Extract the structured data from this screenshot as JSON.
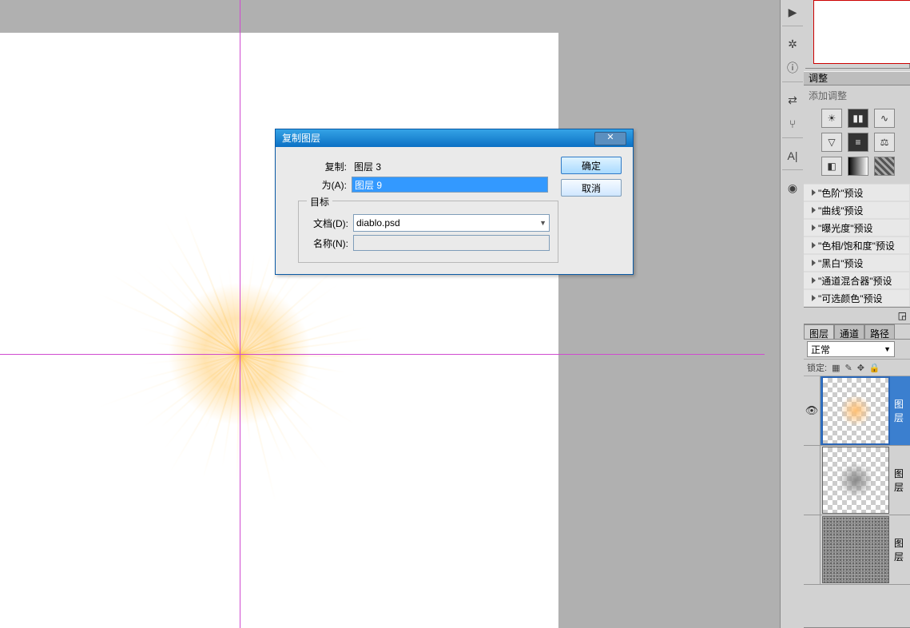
{
  "dialog": {
    "title": "复制图层",
    "copy_label": "复制:",
    "copy_value": "图层 3",
    "as_label": "为(A):",
    "as_value": "图层 9",
    "group_title": "目标",
    "doc_label": "文档(D):",
    "doc_value": "diablo.psd",
    "name_label": "名称(N):",
    "name_value": "",
    "ok": "确定",
    "cancel": "取消",
    "close_glyph": "✕"
  },
  "adjustments": {
    "header": "调整",
    "add_label": "添加调整",
    "presets": [
      "\"色阶\"预设",
      "\"曲线\"预设",
      "\"曝光度\"预设",
      "\"色相/饱和度\"预设",
      "\"黑白\"预设",
      "\"通道混合器\"预设",
      "\"可选颜色\"预设"
    ]
  },
  "layers_panel": {
    "tabs": [
      "图层",
      "通道",
      "路径"
    ],
    "blend_mode": "正常",
    "lock_label": "锁定:",
    "layers": [
      {
        "name": "图层",
        "selected": true,
        "visible": true,
        "thumb": "sun"
      },
      {
        "name": "图层",
        "selected": false,
        "visible": false,
        "thumb": "gray"
      },
      {
        "name": "图层",
        "selected": false,
        "visible": false,
        "thumb": "noise"
      }
    ]
  },
  "toolbar_icons": {
    "play": "▶",
    "wheel": "✲",
    "info": "ⓘ",
    "swap": "⇄",
    "fork": "⑂",
    "text": "A|",
    "camera": "◉"
  }
}
